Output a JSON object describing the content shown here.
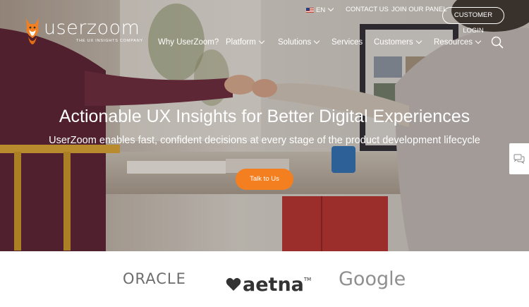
{
  "brand": {
    "name": "userzoom",
    "tagline": "THE UX INSIGHTS COMPANY",
    "accent": "#f47f21"
  },
  "util_nav": {
    "language": "EN",
    "contact": "CONTACT US",
    "join_panel": "JOIN OUR PANEL",
    "login": "CUSTOMER LOGIN"
  },
  "main_nav": {
    "items": [
      {
        "label": "Why UserZoom?",
        "has_dropdown": false
      },
      {
        "label": "Platform",
        "has_dropdown": true
      },
      {
        "label": "Solutions",
        "has_dropdown": true
      },
      {
        "label": "Services",
        "has_dropdown": false
      },
      {
        "label": "Customers",
        "has_dropdown": true
      },
      {
        "label": "Resources",
        "has_dropdown": true
      }
    ],
    "search_icon": "search-icon"
  },
  "hero": {
    "headline": "Actionable UX Insights for Better Digital Experiences",
    "subheadline": "UserZoom enables fast, confident decisions at every stage of the product development lifecycle",
    "cta": "Talk to Us"
  },
  "chat_icon": "chat-bubbles-icon",
  "clients": {
    "oracle": "ORACLE",
    "aetna": "aetna",
    "aetna_tm": "TM",
    "google": "Google"
  }
}
